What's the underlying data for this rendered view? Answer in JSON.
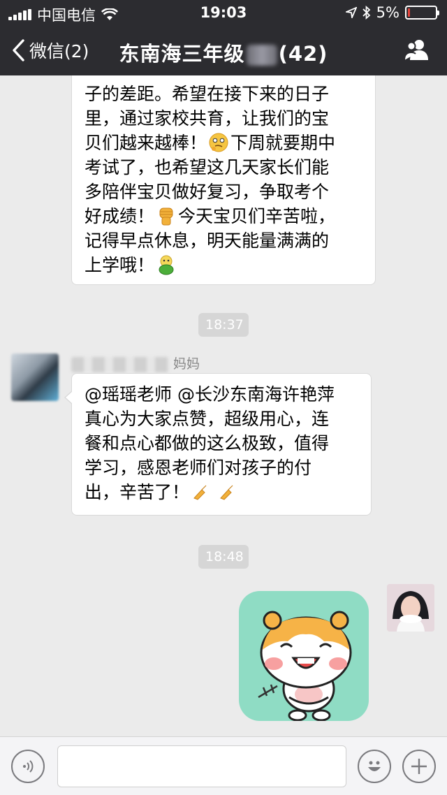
{
  "status_bar": {
    "carrier": "中国电信",
    "time": "19:03",
    "battery_percent": "5%",
    "battery_level": 0.05
  },
  "nav": {
    "back_label": "微信(2)",
    "title_prefix": "东南海三年级",
    "title_suffix": "(42)"
  },
  "messages": {
    "msg1_lines": [
      "子的差距。希望在接下来的日子",
      "里，通过家校共育，让我们的宝",
      "贝们越来越棒！",
      "下周就要期中",
      "考试了，也希望这几天家长们能",
      "多陪伴宝贝做好复习，争取考个",
      "好成绩！",
      "今天宝贝们辛苦啦，",
      "记得早点休息，明天能量满满的",
      "上学哦！"
    ],
    "time1": "18:37",
    "msg2_sender": "妈妈",
    "msg2_lines": [
      "@瑶瑶老师 @长沙东南海许艳萍",
      "真心为大家点赞，超级用心，连",
      "餐和点心都做的这么极致，值得",
      "学习，感恩老师们对孩子的付",
      "出，辛苦了！"
    ],
    "time2": "18:48"
  },
  "input": {
    "value": ""
  },
  "colors": {
    "header_bg": "#2c2c30",
    "chat_bg": "#ebebeb",
    "sticker_bg": "#8fdcc4"
  }
}
